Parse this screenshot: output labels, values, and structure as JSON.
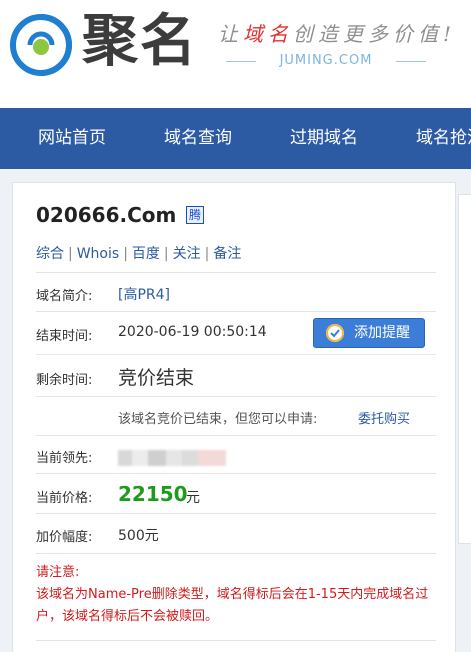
{
  "header": {
    "brand": "聚名",
    "slogan_pre": "让",
    "slogan_highlight": "域名",
    "slogan_post": "创造更多价值!",
    "url": "JUMING.COM",
    "logo_icon": "juming-logo-icon"
  },
  "nav": {
    "items": [
      {
        "label": "网站首页"
      },
      {
        "label": "域名查询"
      },
      {
        "label": "过期域名"
      },
      {
        "label": "域名抢注"
      }
    ]
  },
  "domain": {
    "name": "020666.Com",
    "badge": "腾"
  },
  "links": [
    "综合",
    "Whois",
    "百度",
    "关注",
    "备注"
  ],
  "details": {
    "intro_label": "域名简介:",
    "intro_value": "[高PR4]",
    "end_label": "结束时间:",
    "end_value": "2020-06-19 00:50:14",
    "remind_label": "添加提醒",
    "remain_label": "剩余时间:",
    "remain_value": "竞价结束",
    "ended_note": "该域名竞价已结束，但您可以申请:",
    "entrust_link": "委托购买",
    "leader_label": "当前领先:",
    "price_label": "当前价格:",
    "price_value": "22150",
    "price_unit": "元",
    "increment_label": "加价幅度:",
    "increment_value": "500元"
  },
  "notice": {
    "title": "请注意:",
    "text": "该域名为Name-Pre删除类型，域名得标后会在1-15天内完成域名过户，该域名得标后不会被赎回。"
  },
  "colors": {
    "nav_bg": "#2c5aa3",
    "link": "#2c5aa3",
    "price": "#1e9b1e",
    "notice": "#d41a1a",
    "button": "#3c7dd8"
  }
}
